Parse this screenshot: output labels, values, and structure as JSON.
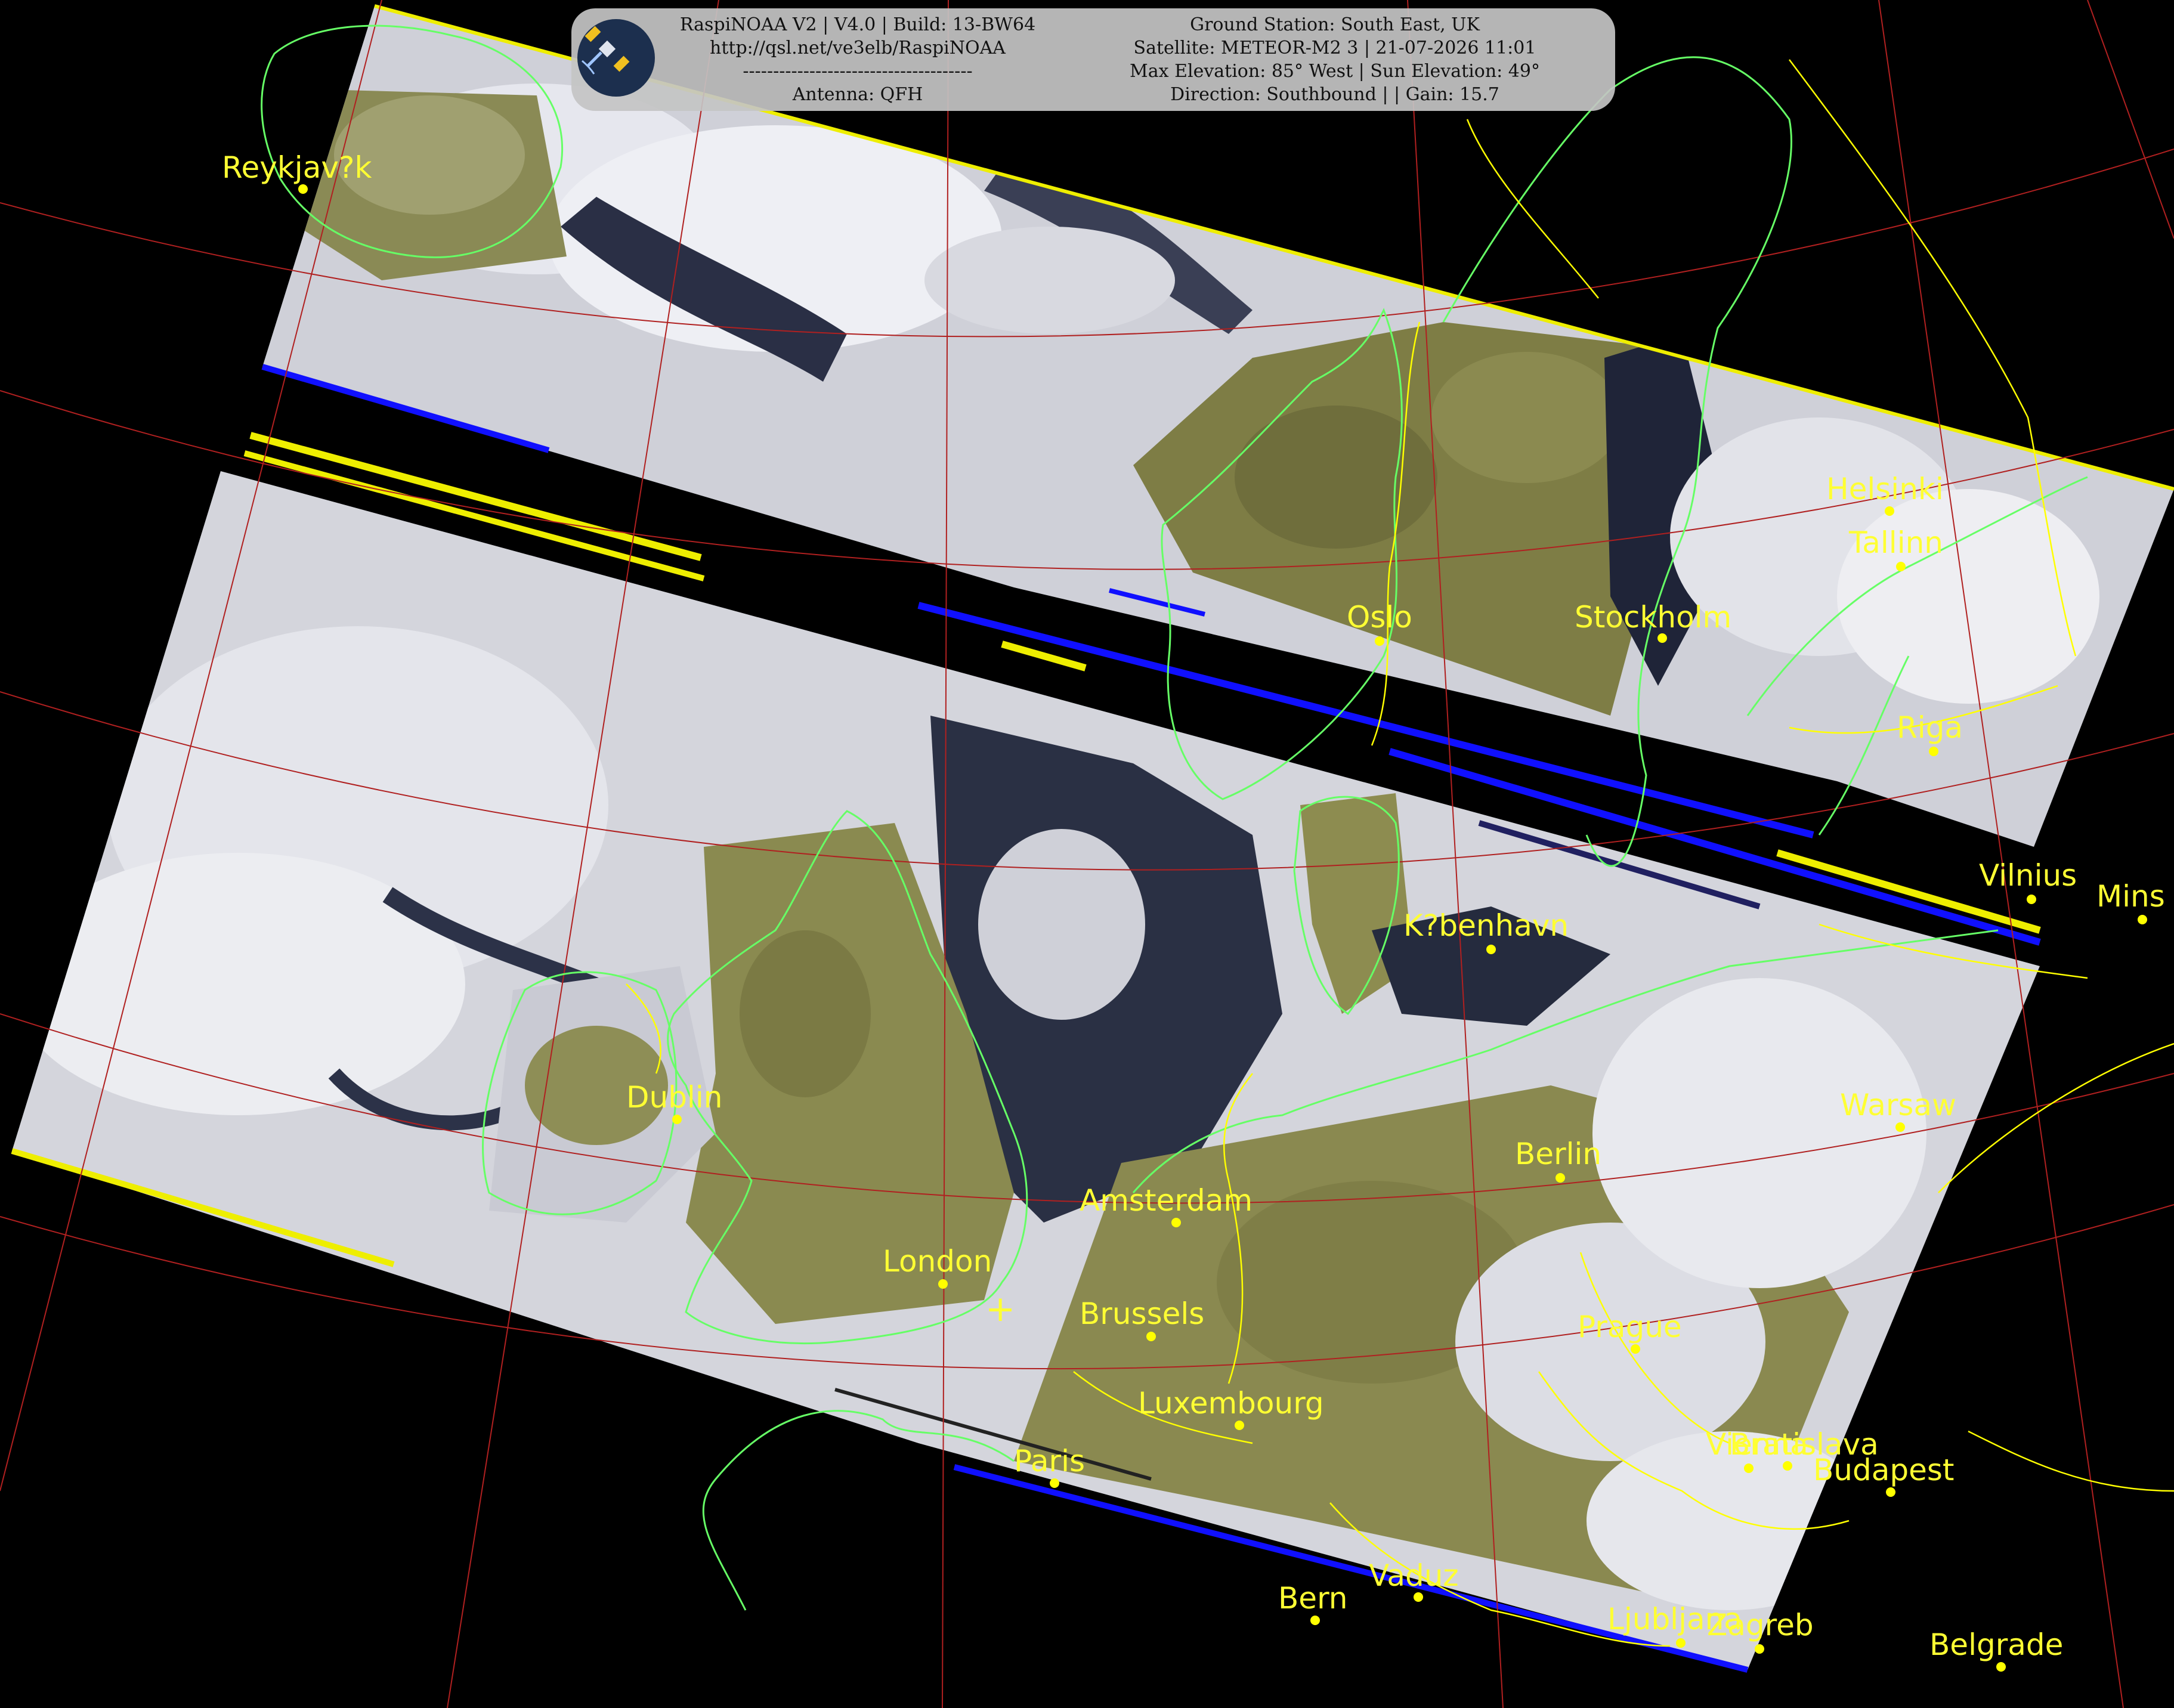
{
  "header": {
    "left_lines": [
      "RaspiNOAA V2 | V4.0 | Build: 13-BW64",
      "http://qsl.net/ve3elb/RaspiNOAA",
      "--------------------------------------",
      "Antenna: QFH"
    ],
    "right_lines": [
      "Ground Station: South East, UK",
      "Satellite: METEOR-M2 3 | 21-07-2026 11:01",
      "Max Elevation: 85° West | Sun Elevation: 49°",
      "Direction: Southbound | | Gain: 15.7"
    ],
    "logo_icon": "satellite-icon"
  },
  "cities": [
    {
      "id": "reykjavik",
      "name": "Reykjav?k"
    },
    {
      "id": "helsinki",
      "name": "Helsinki"
    },
    {
      "id": "tallinn",
      "name": "Tallinn"
    },
    {
      "id": "oslo",
      "name": "Oslo"
    },
    {
      "id": "stockholm",
      "name": "Stockholm"
    },
    {
      "id": "riga",
      "name": "Riga"
    },
    {
      "id": "vilnius",
      "name": "Vilnius"
    },
    {
      "id": "minsk",
      "name": "Mins"
    },
    {
      "id": "kobenhavn",
      "name": "K?benhavn"
    },
    {
      "id": "dublin",
      "name": "Dublin"
    },
    {
      "id": "warsaw",
      "name": "Warsaw"
    },
    {
      "id": "berlin",
      "name": "Berlin"
    },
    {
      "id": "amsterdam",
      "name": "Amsterdam"
    },
    {
      "id": "london",
      "name": "London"
    },
    {
      "id": "brussels",
      "name": "Brussels"
    },
    {
      "id": "prague",
      "name": "Prague"
    },
    {
      "id": "luxembourg",
      "name": "Luxembourg"
    },
    {
      "id": "paris",
      "name": "Paris"
    },
    {
      "id": "vienna",
      "name": "Vienna"
    },
    {
      "id": "bratislava",
      "name": "Bratislava"
    },
    {
      "id": "budapest",
      "name": "Budapest"
    },
    {
      "id": "vaduz",
      "name": "Vaduz"
    },
    {
      "id": "bern",
      "name": "Bern"
    },
    {
      "id": "ljubljana",
      "name": "Ljubljana"
    },
    {
      "id": "zagreb",
      "name": "Zagreb"
    },
    {
      "id": "belgrade",
      "name": "Belgrade"
    }
  ],
  "ground_station_marker": "+",
  "colors": {
    "background": "#000000",
    "graticule": "#b02020",
    "coastline": "#66ff66",
    "borders": "#ffff00",
    "labels": "#ffff33",
    "land": "#8a8a4a",
    "sea": "#22283a",
    "cloud": "#dcdde6"
  }
}
